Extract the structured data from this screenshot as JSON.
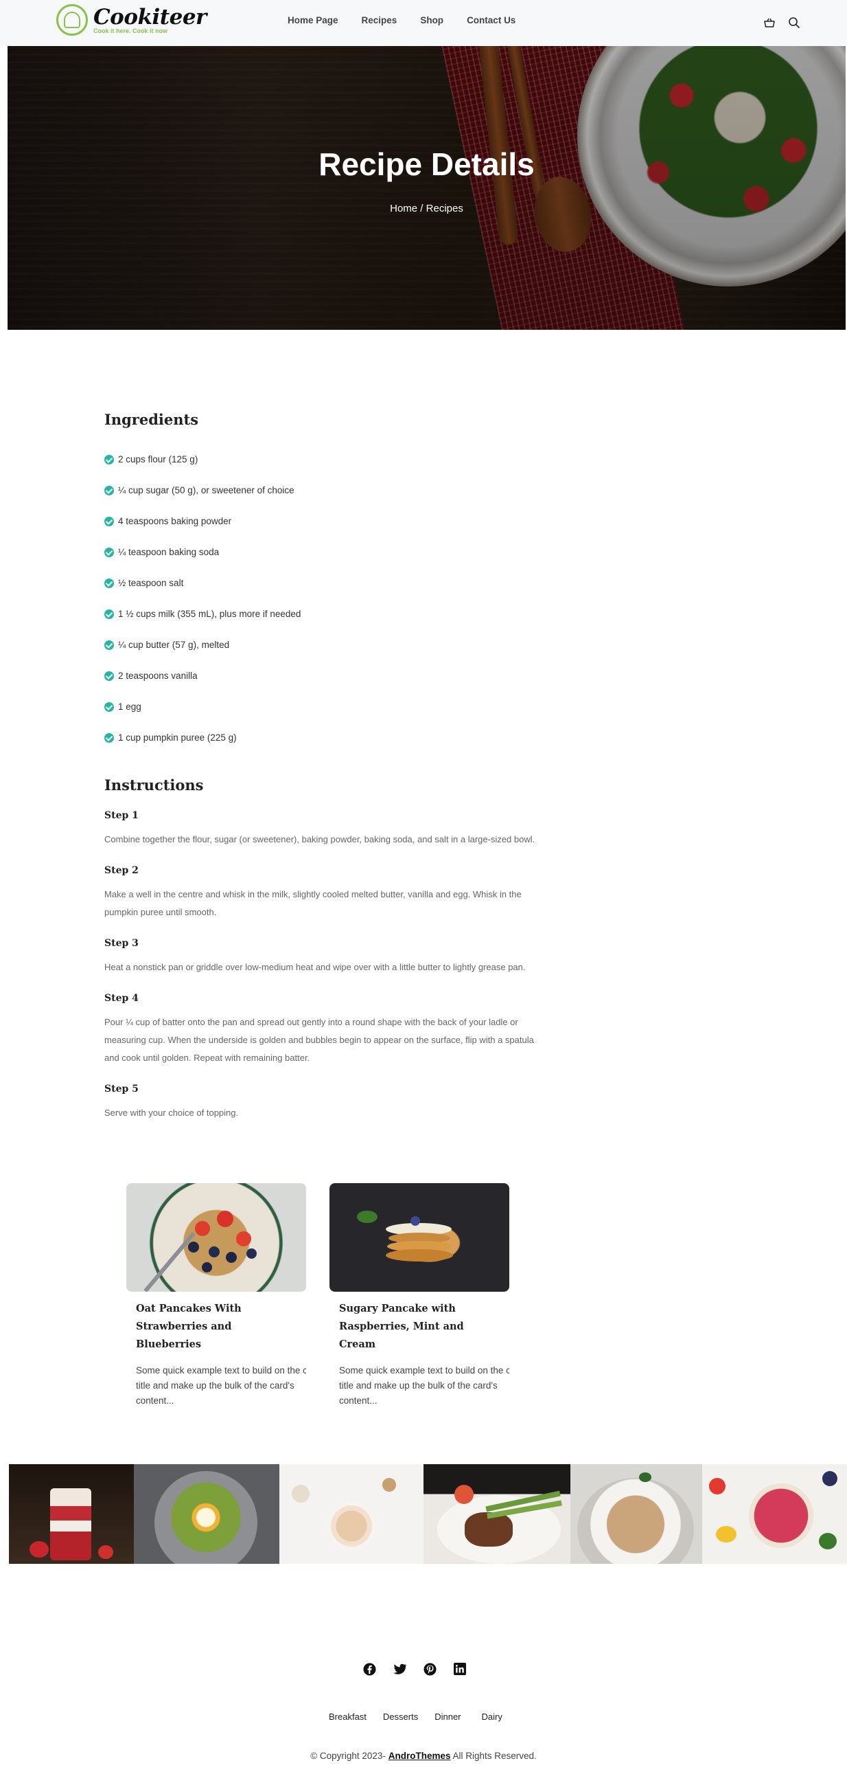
{
  "brand": {
    "name": "Cookiteer",
    "tagline": "Cook it here. Cook it now"
  },
  "nav": {
    "links": [
      "Home Page",
      "Recipes",
      "Shop",
      "Contact Us"
    ]
  },
  "icons": {
    "basket": "basket-icon",
    "search": "search-icon"
  },
  "hero": {
    "title": "Recipe Details",
    "breadcrumb_home": "Home",
    "breadcrumb_sep": " / ",
    "breadcrumb_current": "Recipes"
  },
  "ingredients": {
    "title": "Ingredients",
    "items": [
      "2 cups flour (125 g)",
      "¼ cup sugar (50 g), or sweetener of choice",
      "4 teaspoons baking powder",
      "¼ teaspoon baking soda",
      "½ teaspoon salt",
      "1 ½ cups milk (355 mL), plus more if needed",
      "¼ cup butter (57 g), melted",
      "2 teaspoons vanilla",
      "1 egg",
      "1 cup pumpkin puree (225 g)"
    ]
  },
  "instructions": {
    "title": "Instructions",
    "steps": [
      {
        "title": "Step 1",
        "text": "Combine together the flour, sugar (or sweetener), baking powder, baking soda, and salt in a large-sized bowl."
      },
      {
        "title": "Step 2",
        "text": "Make a well in the centre and whisk in the milk, slightly cooled melted butter, vanilla and egg. Whisk in the pumpkin puree until smooth."
      },
      {
        "title": "Step 3",
        "text": "Heat a nonstick pan or griddle over low-medium heat and wipe over with a little butter to lightly grease pan."
      },
      {
        "title": "Step 4",
        "text": "Pour ¼ cup of batter onto the pan and spread out gently into a round shape with the back of your ladle or measuring cup. When the underside is golden and bubbles begin to appear on the surface, flip with a spatula and cook until golden. Repeat with remaining batter."
      },
      {
        "title": "Step 5",
        "text": "Serve with your choice of topping."
      }
    ]
  },
  "cards": [
    {
      "title": "Oat Pancakes With Strawberries and Blueberries",
      "text_lines": [
        "Some quick example text to build on the ca",
        "title and make up the bulk of the card's",
        "content..."
      ]
    },
    {
      "title": "Sugary Pancake with Raspberries, Mint and Cream",
      "text_lines": [
        "Some quick example text to build on the card",
        "title and make up the bulk of the card's",
        "content..."
      ]
    }
  ],
  "footer": {
    "social": [
      "facebook-icon",
      "twitter-icon",
      "pinterest-icon",
      "linkedin-icon"
    ],
    "links": [
      "Breakfast",
      "Desserts",
      "Dinner",
      "Dairy"
    ],
    "copyright_prefix": "© Copyright 2023-",
    "copyright_brand": "AndroThemes",
    "copyright_suffix": "All Rights Reserved."
  },
  "colors": {
    "accent": "#8bc34a",
    "check": "#26b5a5"
  }
}
